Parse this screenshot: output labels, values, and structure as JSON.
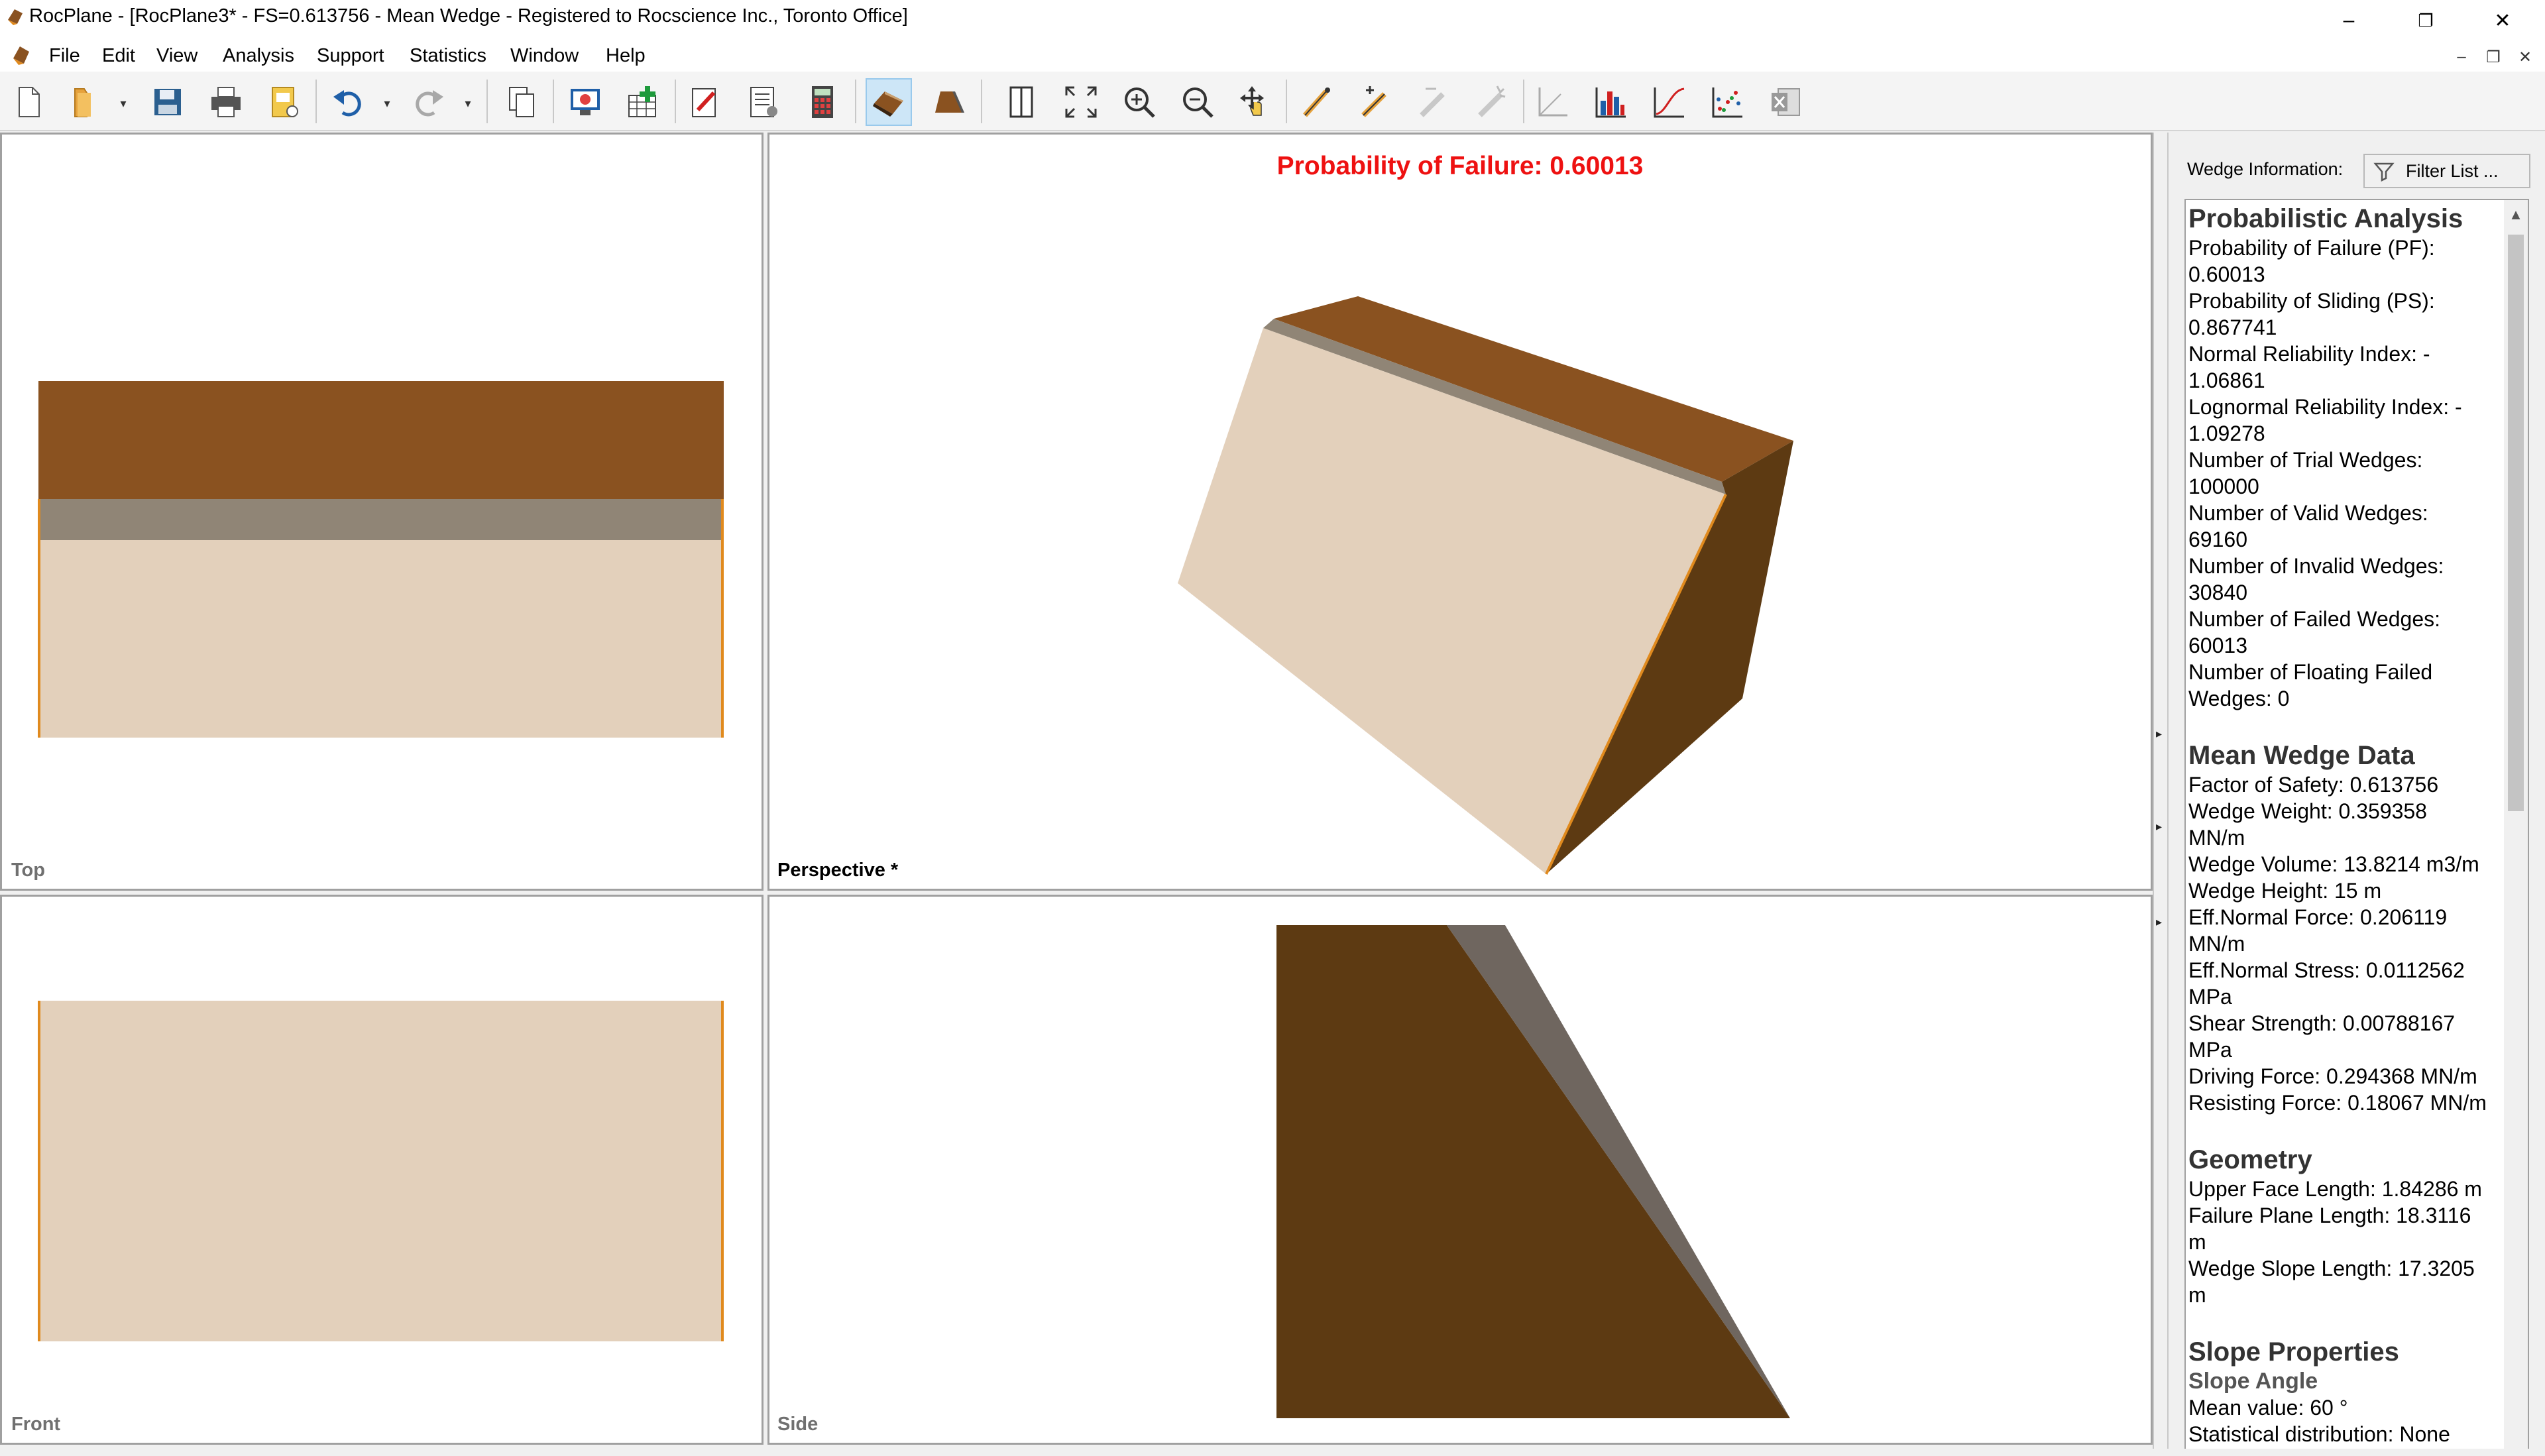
{
  "window": {
    "title": "RocPlane - [RocPlane3* - FS=0.613756 - Mean Wedge - Registered to Rocscience Inc., Toronto Office]",
    "minimize_glyph": "–",
    "restore_glyph": "❐",
    "close_glyph": "✕"
  },
  "menu": {
    "items": [
      "File",
      "Edit",
      "View",
      "Analysis",
      "Support",
      "Statistics",
      "Window",
      "Help"
    ],
    "mdi_minimize": "–",
    "mdi_restore": "❐",
    "mdi_close": "✕"
  },
  "toolbar": {
    "icons": [
      "new-file-icon",
      "open-folder-icon",
      "save-icon",
      "print-icon",
      "print-preview-icon",
      "undo-icon",
      "redo-icon",
      "copy-icon",
      "display-options-icon",
      "add-wedge-icon",
      "edit-input-icon",
      "input-data-icon",
      "calculator-icon",
      "3d-wedge-view-icon",
      "2d-wedge-view-icon",
      "view-tile-icon",
      "zoom-all-icon",
      "zoom-in-icon",
      "zoom-out-icon",
      "pan-icon",
      "pick-wedge-icon",
      "add-pick-icon",
      "remove-pick-icon",
      "clear-picks-icon",
      "chart-axes-icon",
      "histogram-icon",
      "cumulative-plot-icon",
      "scatter-plot-icon",
      "export-excel-icon"
    ]
  },
  "viewports": {
    "top": {
      "label": "Top"
    },
    "perspective": {
      "label": "Perspective *",
      "pf_text": "Probability of Failure: 0.60013"
    },
    "front": {
      "label": "Front"
    },
    "side": {
      "label": "Side"
    }
  },
  "colors": {
    "wedge_top": "#8a5220",
    "wedge_face": "#e3d0bb",
    "wedge_grey": "#908576",
    "wedge_dark": "#5d3a12",
    "failure_edge": "#e08a1e",
    "pf_text": "#ee1111"
  },
  "panel": {
    "wedge_info_label": "Wedge Information:",
    "filter_button": "Filter List ...",
    "sections": [
      {
        "title": "Probabilistic Analysis",
        "lines": [
          "Probability of Failure (PF):",
          "0.60013",
          "Probability of Sliding (PS):",
          "0.867741",
          "Normal Reliability Index: -",
          "1.06861",
          "Lognormal Reliability Index: -",
          "1.09278",
          "Number of Trial Wedges:",
          "100000",
          "Number of Valid Wedges:",
          "69160",
          "Number of Invalid Wedges:",
          "30840",
          "Number of Failed Wedges:",
          "60013",
          "Number of Floating Failed",
          "Wedges: 0"
        ]
      },
      {
        "title": "Mean Wedge Data",
        "lines": [
          "Factor of Safety: 0.613756",
          "Wedge Weight: 0.359358",
          "MN/m",
          "Wedge Volume: 13.8214 m3/m",
          "Wedge Height: 15 m",
          "Eff.Normal Force: 0.206119",
          "MN/m",
          "Eff.Normal Stress: 0.0112562",
          "MPa",
          "Shear Strength: 0.00788167",
          "MPa",
          "Driving Force: 0.294368 MN/m",
          "Resisting Force: 0.18067 MN/m"
        ]
      },
      {
        "title": "Geometry",
        "lines": [
          "Upper Face Length: 1.84286 m",
          "Failure Plane Length: 18.3116",
          "m",
          "Wedge Slope Length: 17.3205",
          "m"
        ]
      },
      {
        "title": "Slope Properties",
        "subtitle": "Slope Angle",
        "lines": [
          "Mean value: 60 °",
          "Statistical distribution: None"
        ]
      }
    ]
  }
}
